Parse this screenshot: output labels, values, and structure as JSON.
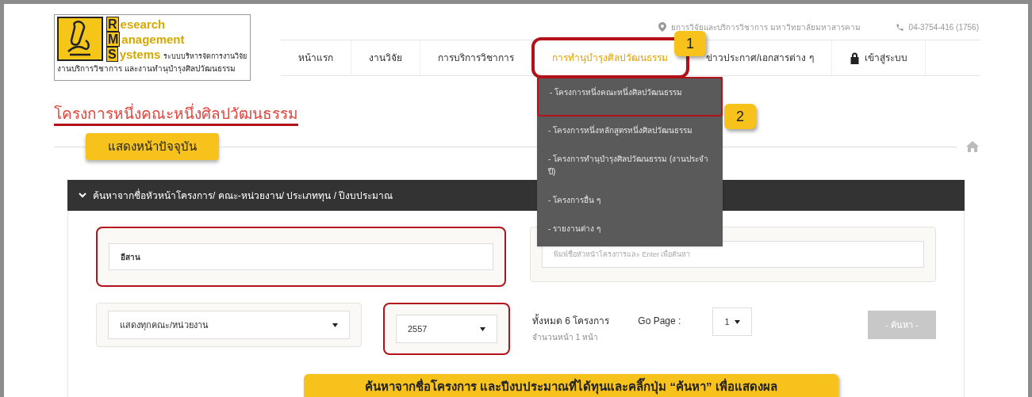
{
  "logo": {
    "letters": [
      "R",
      "M",
      "S"
    ],
    "words": [
      "esearch",
      "anagement",
      "ystems"
    ],
    "tagline": "ระบบบริหารจัดการงานวิจัย",
    "subtitle": "งานบริการวิชาการ และงานทำนุบำรุงศิลปวัฒนธรรม"
  },
  "top_bar": {
    "address": "ยการวิจัยและบริการวิชาการ มหาวิทยาลัยมหาสารคาม",
    "phone": "04-3754-416 (1756)"
  },
  "nav": [
    {
      "label": "หน้าแรก",
      "kind": "link",
      "selected": false,
      "highlighted": false
    },
    {
      "label": "งานวิจัย",
      "kind": "link",
      "selected": false,
      "highlighted": false
    },
    {
      "label": "การบริการวิชาการ",
      "kind": "link",
      "selected": false,
      "highlighted": false
    },
    {
      "label": "การทำนุบำรุงศิลปวัฒนธรรม",
      "kind": "link",
      "selected": true,
      "highlighted": true,
      "callout": "1"
    },
    {
      "label": "ข่าวประกาศ/เอกสารต่าง ๆ",
      "kind": "link",
      "selected": false,
      "highlighted": false
    },
    {
      "label": "เข้าสู่ระบบ",
      "kind": "login",
      "selected": false,
      "highlighted": false
    }
  ],
  "dropdown": [
    {
      "label": "- โครงการหนึ่งคณะหนึ่งศิลปวัฒนธรรม",
      "highlighted": true,
      "callout": "2"
    },
    {
      "label": "- โครงการหนึ่งหลักสูตรหนึ่งศิลปวัฒนธรรม",
      "highlighted": false
    },
    {
      "label": "- โครงการทำนุบำรุงศิลปวัฒนธรรม (งานประจำปี)",
      "highlighted": false
    },
    {
      "label": "- โครงการอื่น ๆ",
      "highlighted": false
    },
    {
      "label": "- รายงานต่าง ๆ",
      "highlighted": false
    }
  ],
  "page_title": "โครงการหนึ่งคณะหนึ่งศิลปวัฒนธรรม",
  "current_page_button": "แสดงหน้าปัจจุบัน",
  "search_panel": {
    "title": "ค้นหาจากชื่อหัวหน้าโครงการ/ คณะ-หน่วยงาน/ ประเภททุน / ปีงบประมาณ",
    "expanded": true,
    "name_field": {
      "value": "อีสาน",
      "highlighted": true
    },
    "keyword_field": {
      "placeholder": "พิมพ์ชื่อหัวหน้าโครงการและ Enter เพื่อค้นหา",
      "highlighted": false
    },
    "unit_select": {
      "value": "แสดงทุกคณะ/หน่วยงาน",
      "highlighted": false
    },
    "year_select": {
      "value": "2557",
      "highlighted": true
    },
    "total": "ทั้งหมด 6 โครงการ",
    "pages": "จำนวนหน้า 1 หน้า",
    "go_page_label": "Go Page :",
    "page_select": {
      "value": "1"
    },
    "search_button": "- ค้นหา -"
  },
  "instruction_banner": "ค้นหาจากชื่อโครงการ และปีงบประมาณที่ได้ทุนและคลิ๊กปุ่ม “ค้นหา” เพื่อแสดงผล"
}
